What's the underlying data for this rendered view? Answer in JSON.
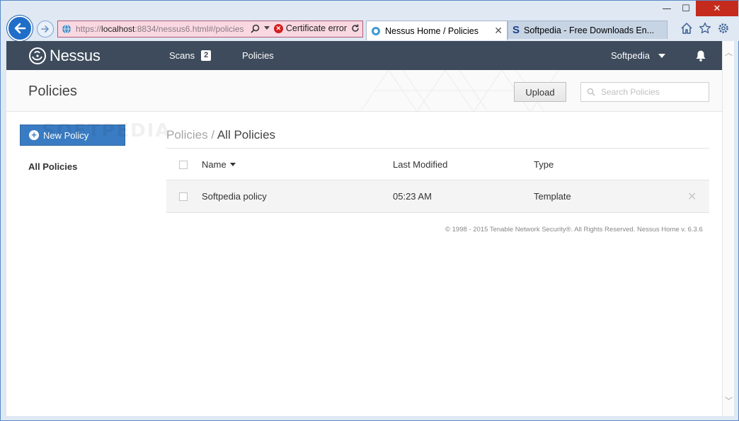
{
  "browser": {
    "window_controls": {
      "minimize": "—",
      "maximize": "☐",
      "close": "✕"
    },
    "address": {
      "url_prefix": "https://",
      "url_host": "localhost",
      "url_rest": ":8834/nessus6.html#/policies",
      "certificate_text": "Certificate error"
    },
    "tabs": [
      {
        "title": "Nessus Home / Policies",
        "close": "✕"
      },
      {
        "title": "Softpedia - Free Downloads En..."
      }
    ]
  },
  "nav": {
    "brand": "Nessus",
    "scans_label": "Scans",
    "scans_count": "2",
    "policies_label": "Policies",
    "user_name": "Softpedia"
  },
  "title_bar": {
    "title": "Policies",
    "upload_label": "Upload",
    "search_placeholder": "Search Policies"
  },
  "sidebar": {
    "new_policy_label": "New Policy",
    "watermark": "SOFTPEDIA",
    "all_policies_label": "All Policies"
  },
  "main": {
    "breadcrumb_root": "Policies",
    "breadcrumb_sep": " / ",
    "breadcrumb_current": "All Policies",
    "columns": {
      "name": "Name",
      "last_modified": "Last Modified",
      "type": "Type"
    },
    "rows": [
      {
        "name": "Softpedia policy",
        "last_modified": "05:23 AM",
        "type": "Template",
        "delete": "✕"
      }
    ],
    "footer": "© 1998 - 2015 Tenable Network Security®. All Rights Reserved. Nessus Home v. 6.3.6"
  },
  "colors": {
    "nav_bg": "#3d4b5c",
    "primary_button": "#3a7cc3",
    "address_error_bg": "#f9d8e2"
  }
}
